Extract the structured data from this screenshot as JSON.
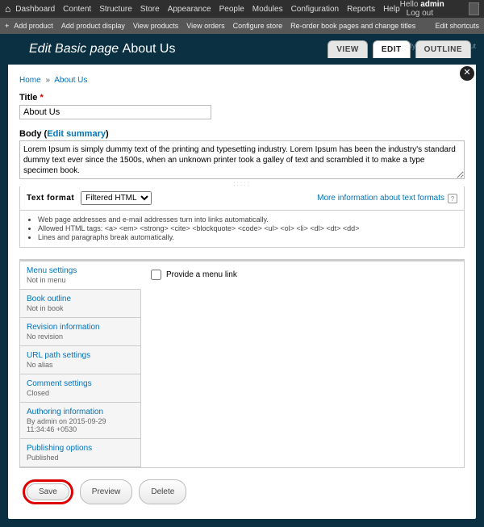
{
  "admin_menu": {
    "items": [
      "Dashboard",
      "Content",
      "Structure",
      "Store",
      "Appearance",
      "People",
      "Modules",
      "Configuration",
      "Reports",
      "Help"
    ],
    "hello": "Hello",
    "user": "admin",
    "logout": "Log out"
  },
  "shortcuts": {
    "items": [
      "Add product",
      "Add product display",
      "View products",
      "View orders",
      "Configure store",
      "Re-order book pages and change titles"
    ],
    "edit": "Edit shortcuts"
  },
  "header": {
    "title_prefix": "Edit Basic page",
    "title_name": "About Us",
    "my_account": "My account",
    "logout": "Log out"
  },
  "tabs": {
    "view": "VIEW",
    "edit": "EDIT",
    "outline": "OUTLINE"
  },
  "breadcrumb": {
    "home": "Home",
    "current": "About Us"
  },
  "title_field": {
    "label": "Title",
    "value": "About Us"
  },
  "body": {
    "label": "Body",
    "edit_summary": "Edit summary",
    "value": "Lorem Ipsum is simply dummy text of the printing and typesetting industry. Lorem Ipsum has been the industry's standard dummy text ever since the 1500s, when an unknown printer took a galley of text and scrambled it to make a type specimen book."
  },
  "format": {
    "label": "Text format",
    "selected": "Filtered HTML",
    "more": "More information about text formats",
    "tips": [
      "Web page addresses and e-mail addresses turn into links automatically.",
      "Allowed HTML tags: <a> <em> <strong> <cite> <blockquote> <code> <ul> <ol> <li> <dl> <dt> <dd>",
      "Lines and paragraphs break automatically."
    ]
  },
  "vtabs": [
    {
      "title": "Menu settings",
      "summary": "Not in menu"
    },
    {
      "title": "Book outline",
      "summary": "Not in book"
    },
    {
      "title": "Revision information",
      "summary": "No revision"
    },
    {
      "title": "URL path settings",
      "summary": "No alias"
    },
    {
      "title": "Comment settings",
      "summary": "Closed"
    },
    {
      "title": "Authoring information",
      "summary": "By admin on 2015-09-29 11:34:46 +0530"
    },
    {
      "title": "Publishing options",
      "summary": "Published"
    }
  ],
  "menu_pane": {
    "checkbox_label": "Provide a menu link"
  },
  "buttons": {
    "save": "Save",
    "preview": "Preview",
    "delete": "Delete"
  }
}
